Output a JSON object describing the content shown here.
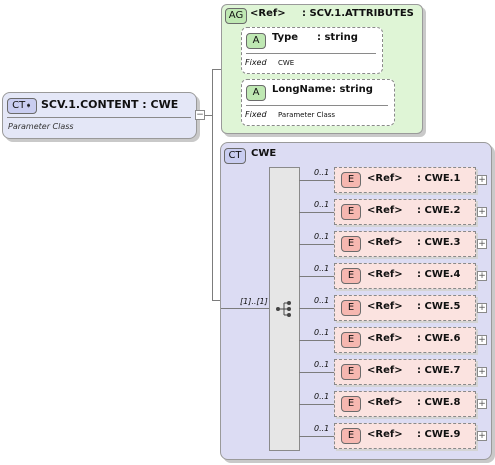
{
  "content_type": {
    "badge": "CT",
    "name": "SCV.1.CONTENT : CWE",
    "description": "Parameter Class"
  },
  "attribute_group": {
    "badge": "AG",
    "ref": "<Ref>",
    "name": ": SCV.1.ATTRIBUTES",
    "attributes": [
      {
        "badge": "A",
        "name": "Type",
        "type": ": string",
        "fixed_label": "Fixed",
        "fixed_value": "CWE"
      },
      {
        "badge": "A",
        "name": "LongName",
        "type": ": string",
        "fixed_label": "Fixed",
        "fixed_value": "Parameter Class"
      }
    ]
  },
  "complex_type": {
    "badge": "CT",
    "name": "CWE",
    "multiplicity": "[1]..[1]"
  },
  "elements": [
    {
      "badge": "E",
      "ref": "<Ref>",
      "name": ": CWE.1",
      "occurs": "0..1"
    },
    {
      "badge": "E",
      "ref": "<Ref>",
      "name": ": CWE.2",
      "occurs": "0..1"
    },
    {
      "badge": "E",
      "ref": "<Ref>",
      "name": ": CWE.3",
      "occurs": "0..1"
    },
    {
      "badge": "E",
      "ref": "<Ref>",
      "name": ": CWE.4",
      "occurs": "0..1"
    },
    {
      "badge": "E",
      "ref": "<Ref>",
      "name": ": CWE.5",
      "occurs": "0..1"
    },
    {
      "badge": "E",
      "ref": "<Ref>",
      "name": ": CWE.6",
      "occurs": "0..1"
    },
    {
      "badge": "E",
      "ref": "<Ref>",
      "name": ": CWE.7",
      "occurs": "0..1"
    },
    {
      "badge": "E",
      "ref": "<Ref>",
      "name": ": CWE.8",
      "occurs": "0..1"
    },
    {
      "badge": "E",
      "ref": "<Ref>",
      "name": ": CWE.9",
      "occurs": "0..1"
    }
  ],
  "colors": {
    "content_box": "#e4e7f7",
    "attribute_group": "#dff5d6",
    "attribute_box": "#ffffff",
    "complex_type_box": "#dcdcf3",
    "element_box": "#fbe3e0",
    "element_badge": "#f6b7b0",
    "attribute_badge": "#bfe8b3",
    "ct_badge": "#c9cdf0"
  }
}
